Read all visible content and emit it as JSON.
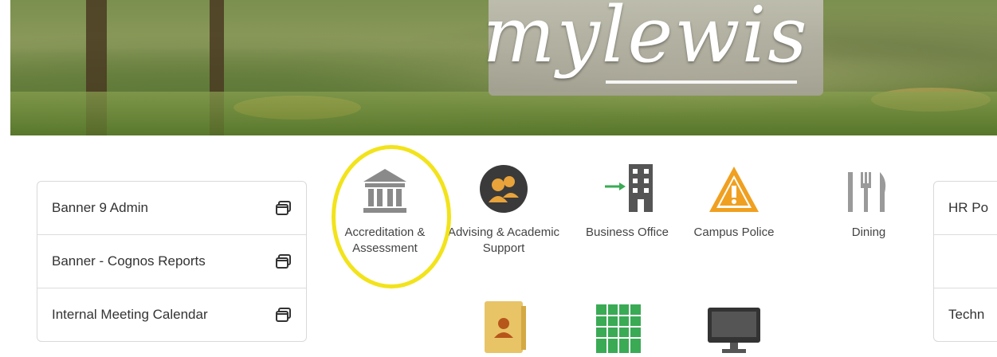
{
  "banner": {
    "logo_text": "mylewis"
  },
  "quick_links": [
    {
      "label": "Banner 9 Admin",
      "icon": "new-window-icon"
    },
    {
      "label": "Banner - Cognos Reports",
      "icon": "new-window-icon"
    },
    {
      "label": "Internal Meeting Calendar",
      "icon": "new-window-icon"
    }
  ],
  "apps_row1": [
    {
      "label": "Accreditation & Assessment",
      "icon": "institution-building-icon",
      "color": "#8a8a8a"
    },
    {
      "label": "Advising & Academic Support",
      "icon": "people-group-icon",
      "color": "#e8a33a"
    },
    {
      "label": "Business Office",
      "icon": "office-building-icon",
      "color": "#555555"
    },
    {
      "label": "Campus Police",
      "icon": "warning-icon",
      "color": "#f0a020"
    },
    {
      "label": "Dining",
      "icon": "fork-knife-icon",
      "color": "#9a9a9a"
    }
  ],
  "apps_row2": [
    {
      "icon": "contact-card-icon",
      "color": "#e8c466"
    },
    {
      "icon": "spreadsheet-icon",
      "color": "#3aaa55"
    },
    {
      "icon": "monitor-icon",
      "color": "#333333"
    }
  ],
  "right_panel": [
    {
      "label": "HR Po"
    },
    {
      "label": ""
    },
    {
      "label": "Techn"
    }
  ],
  "colors": {
    "highlight": "#f2e31b",
    "panel_border": "#d9d9d9"
  }
}
